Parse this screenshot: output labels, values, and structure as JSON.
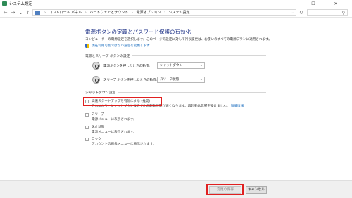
{
  "window": {
    "title": "システム設定",
    "minimize": "—",
    "maximize": "☐",
    "close": "✕"
  },
  "nav": {
    "back": "←",
    "forward": "→",
    "recent": "⌄",
    "up": "↑",
    "breadcrumb": [
      "コントロール パネル",
      "ハードウェアとサウンド",
      "電源オプション",
      "システム設定"
    ],
    "separator": "›",
    "address_dropdown": "⌄",
    "refresh": "↻",
    "search_placeholder": "",
    "search_icon": "⚲"
  },
  "page": {
    "heading": "電源ボタンの定義とパスワード保護の有効化",
    "description": "コンピューターの電源設定を選択します。このページの設定に対して行う変更は、お使いのすべての電源プランに適用されます。",
    "admin_link": "現在利用可能ではない設定を変更します"
  },
  "power_section": {
    "title": "電源とスリープ ボタンの設定",
    "rows": [
      {
        "label": "電源ボタンを押したときの動作:",
        "value": "シャットダウン",
        "arrow": "⌄"
      },
      {
        "label": "スリープ ボタンを押したときの動作:",
        "value": "スリープ状態",
        "arrow": "⌄"
      }
    ]
  },
  "shutdown_section": {
    "title": "シャットダウン設定",
    "items": [
      {
        "label": "高速スタートアップを有効にする (推奨)",
        "desc": "これにより、シャットダウン後の PC の起動時間が速くなります。再起動は影響を受けません。",
        "more": "詳細情報",
        "checked": false
      },
      {
        "label": "スリープ",
        "desc": "電源メニューに表示されます。",
        "checked": false
      },
      {
        "label": "休止状態",
        "desc": "電源メニューに表示されます。",
        "checked": false
      },
      {
        "label": "ロック",
        "desc": "アカウントの画像メニューに表示されます。",
        "checked": false
      }
    ]
  },
  "footer": {
    "save_label": "変更の保存",
    "cancel_label": "キャンセル"
  },
  "colors": {
    "heading": "#1e3287",
    "link": "#1d6fbf",
    "highlight": "#e02020"
  }
}
